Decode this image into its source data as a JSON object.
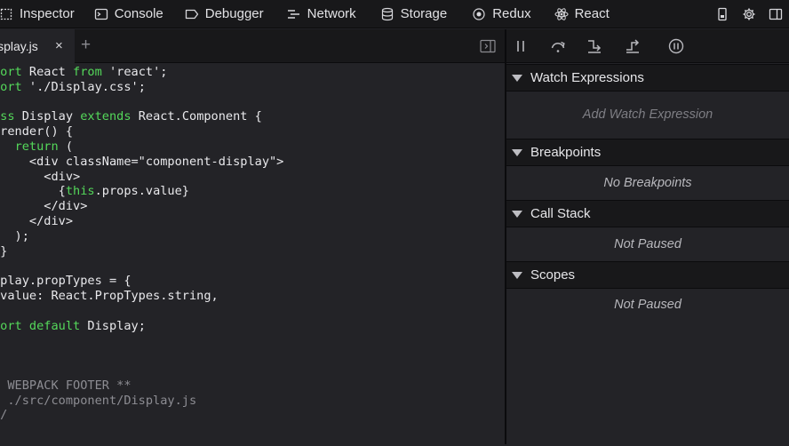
{
  "toolbar": {
    "tabs": [
      {
        "label": "Inspector",
        "icon": "inspector-icon"
      },
      {
        "label": "Console",
        "icon": "console-icon"
      },
      {
        "label": "Debugger",
        "icon": "debugger-icon"
      },
      {
        "label": "Network",
        "icon": "network-icon"
      },
      {
        "label": "Storage",
        "icon": "storage-icon"
      },
      {
        "label": "Redux",
        "icon": "redux-icon"
      },
      {
        "label": "React",
        "icon": "react-icon"
      }
    ],
    "right_icons": [
      "responsive-mode-icon",
      "settings-gear-icon",
      "dock-side-icon"
    ]
  },
  "editor": {
    "file_tab": {
      "label": "isplay.js",
      "close": "×"
    },
    "add_tab": "+",
    "code_lines": [
      [
        {
          "t": "port",
          "c": "kw"
        },
        {
          "t": " React ",
          "c": ""
        },
        {
          "t": "from",
          "c": "kw"
        },
        {
          "t": " 'react';",
          "c": "str"
        }
      ],
      [
        {
          "t": "port",
          "c": "kw"
        },
        {
          "t": " './Display.css';",
          "c": "str"
        }
      ],
      [
        {
          "t": "",
          "c": ""
        }
      ],
      [
        {
          "t": "ass",
          "c": "kw"
        },
        {
          "t": " Display ",
          "c": ""
        },
        {
          "t": "extends",
          "c": "kw"
        },
        {
          "t": " React.Component {",
          "c": ""
        }
      ],
      [
        {
          "t": " render() {",
          "c": ""
        }
      ],
      [
        {
          "t": "   ",
          "c": ""
        },
        {
          "t": "return",
          "c": "kw"
        },
        {
          "t": " (",
          "c": ""
        }
      ],
      [
        {
          "t": "     <div className=\"component-display\">",
          "c": ""
        }
      ],
      [
        {
          "t": "       <div>",
          "c": ""
        }
      ],
      [
        {
          "t": "         {",
          "c": ""
        },
        {
          "t": "this",
          "c": "kw"
        },
        {
          "t": ".props.value}",
          "c": ""
        }
      ],
      [
        {
          "t": "       </div>",
          "c": ""
        }
      ],
      [
        {
          "t": "     </div>",
          "c": ""
        }
      ],
      [
        {
          "t": "   );",
          "c": ""
        }
      ],
      [
        {
          "t": " }",
          "c": ""
        }
      ],
      [
        {
          "t": "",
          "c": ""
        }
      ],
      [
        {
          "t": "splay.propTypes = {",
          "c": ""
        }
      ],
      [
        {
          "t": " value: React.PropTypes.string,",
          "c": ""
        }
      ],
      [
        {
          "t": "",
          "c": ""
        }
      ],
      [
        {
          "t": "port default",
          "c": "kw"
        },
        {
          "t": " Display;",
          "c": ""
        }
      ],
      [
        {
          "t": "",
          "c": ""
        }
      ],
      [
        {
          "t": "",
          "c": ""
        }
      ],
      [
        {
          "t": "",
          "c": ""
        }
      ],
      [
        {
          "t": "* WEBPACK FOOTER **",
          "c": "cm"
        }
      ],
      [
        {
          "t": "* ./src/component/Display.js",
          "c": "cm"
        }
      ],
      [
        {
          "t": "*/",
          "c": "cm"
        }
      ]
    ]
  },
  "debugger": {
    "controls": [
      "pause-icon",
      "step-over-icon",
      "step-in-icon",
      "step-out-icon",
      "pause-on-exceptions-icon"
    ],
    "sections": {
      "watch": {
        "title": "Watch Expressions",
        "body": "Add Watch Expression"
      },
      "breakpoints": {
        "title": "Breakpoints",
        "body": "No Breakpoints"
      },
      "callstack": {
        "title": "Call Stack",
        "body": "Not Paused"
      },
      "scopes": {
        "title": "Scopes",
        "body": "Not Paused"
      }
    }
  },
  "colors": {
    "background": "#232327",
    "toolbar": "#18181a",
    "keyword": "#54d85a",
    "comment": "#8d8d93"
  }
}
